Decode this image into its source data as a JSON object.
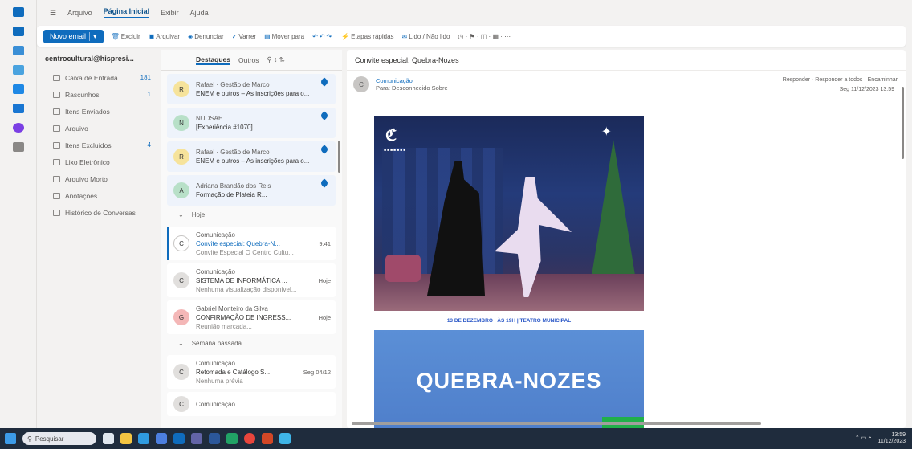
{
  "ribbon": {
    "tabs": [
      "Arquivo",
      "Página Inicial",
      "Exibir",
      "Ajuda"
    ],
    "active_tab": "Página Inicial"
  },
  "toolbar": {
    "new_mail": "Novo email",
    "items": [
      "Excluir",
      "Arquivar",
      "Denunciar",
      "Varrer",
      "Mover para",
      "Etapas rápidas",
      "Lido / Não lido"
    ]
  },
  "folders": {
    "account": "centrocultural@hispresi...",
    "items": [
      {
        "label": "Caixa de Entrada",
        "count": "181"
      },
      {
        "label": "Rascunhos",
        "count": "1"
      },
      {
        "label": "Itens Enviados",
        "count": ""
      },
      {
        "label": "Arquivo",
        "count": ""
      },
      {
        "label": "Itens Excluídos",
        "count": "4"
      },
      {
        "label": "Lixo Eletrônico",
        "count": ""
      },
      {
        "label": "Arquivo Morto",
        "count": ""
      },
      {
        "label": "Anotações",
        "count": ""
      },
      {
        "label": "Histórico de Conversas",
        "count": ""
      }
    ]
  },
  "list": {
    "tab_focused": "Destaques",
    "tab_other": "Outros",
    "groups": [
      "Hoje",
      "Semana passada"
    ],
    "pinned": [
      {
        "initial": "R",
        "sender": "Rafael · Gestão de Marco",
        "subject": "ENEM e outros – As inscrições para o...",
        "color": "#f6e39b"
      },
      {
        "initial": "N",
        "sender": "NUDSAE",
        "subject": "[Experiência #1070]...",
        "color": "#b8e0c8"
      },
      {
        "initial": "R",
        "sender": "Rafael · Gestão de Marco",
        "subject": "ENEM e outros – As inscrições para o...",
        "color": "#f6e39b"
      },
      {
        "initial": "A",
        "sender": "Adriana Brandão dos Reis",
        "subject": "Formação de Plateia R...",
        "color": "#b8e0c8"
      }
    ],
    "today": [
      {
        "initial": "C",
        "sender": "Comunicação",
        "subject": "Convite especial: Quebra-N...",
        "time": "9:41",
        "preview": "Convite Especial O Centro Cultu...",
        "color": "#ffffff"
      },
      {
        "initial": "C",
        "sender": "Comunicação",
        "subject": "SISTEMA DE INFORMÁTICA ...",
        "time": "Hoje",
        "preview": "Nenhuma visualização disponível...",
        "color": "#e1dfdd"
      },
      {
        "initial": "G",
        "sender": "Gabriel Monteiro da Silva",
        "subject": "CONFIRMAÇÃO DE INGRESS...",
        "time": "Hoje",
        "preview": "Reunião marcada...",
        "color": "#f4b7b7"
      }
    ],
    "last_week": [
      {
        "initial": "C",
        "sender": "Comunicação",
        "subject": "Retomada e Catálogo S...",
        "time": "Seg 04/12",
        "preview": "Nenhuma prévia",
        "color": "#e1dfdd"
      },
      {
        "initial": "C",
        "sender": "Comunicação",
        "subject": "",
        "time": "",
        "preview": "",
        "color": "#e1dfdd"
      }
    ]
  },
  "reader": {
    "subject": "Convite especial: Quebra-Nozes",
    "from_name": "Comunicação",
    "to_line": "Para: Desconhecido Sobre",
    "actions": "Responder · Responder a todos · Encaminhar",
    "date": "Seg 11/12/2023 13:59",
    "poster": {
      "strip_text": "13 DE DEZEMBRO | ÀS 19H | TEATRO MUNICIPAL",
      "title": "QUEBRA-NOZES"
    }
  },
  "taskbar": {
    "search_placeholder": "Pesquisar",
    "time": "13:59",
    "date": "11/12/2023"
  }
}
